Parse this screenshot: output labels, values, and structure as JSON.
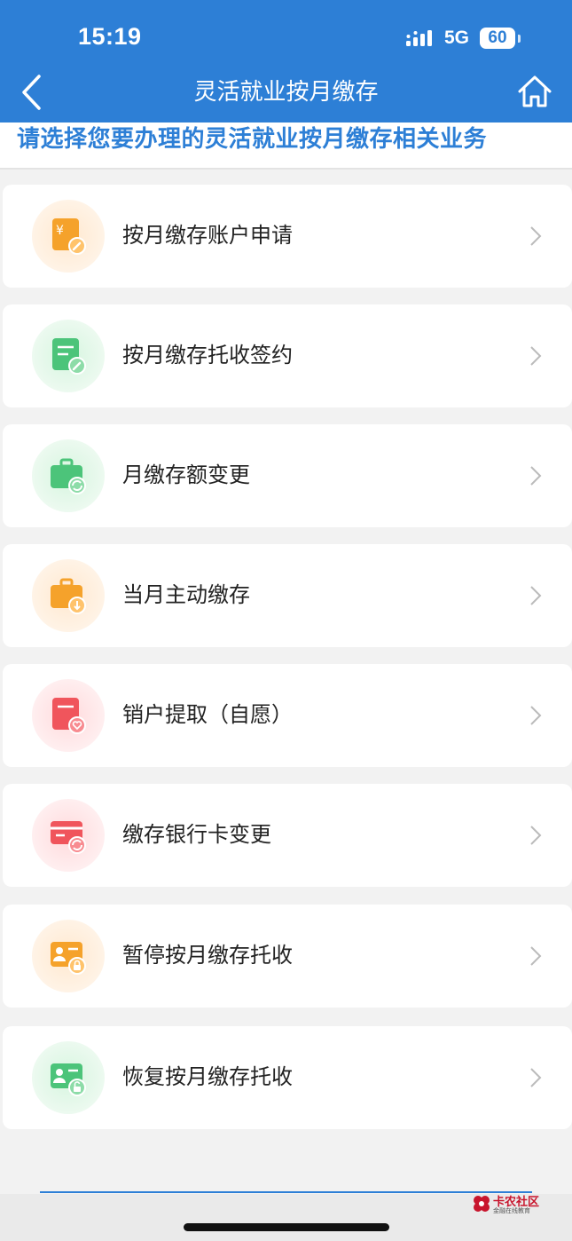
{
  "status_bar": {
    "time": "15:19",
    "network": "5G",
    "battery": "60"
  },
  "header": {
    "title": "灵活就业按月缴存",
    "back_icon": "chevron-left-icon",
    "home_icon": "home-icon"
  },
  "banner": {
    "text": "请选择您要办理的灵活就业按月缴存相关业务"
  },
  "menu": {
    "items": [
      {
        "label": "按月缴存账户申请",
        "icon": "account-apply-icon",
        "color": "#f5a22b"
      },
      {
        "label": "按月缴存托收签约",
        "icon": "contract-sign-icon",
        "color": "#4cc47a"
      },
      {
        "label": "月缴存额变更",
        "icon": "amount-change-icon",
        "color": "#4cc47a"
      },
      {
        "label": "当月主动缴存",
        "icon": "active-deposit-icon",
        "color": "#f5a22b"
      },
      {
        "label": "销户提取（自愿）",
        "icon": "close-account-icon",
        "color": "#f0555c"
      },
      {
        "label": "缴存银行卡变更",
        "icon": "bank-card-change-icon",
        "color": "#f0555c"
      },
      {
        "label": "暂停按月缴存托收",
        "icon": "pause-collection-icon",
        "color": "#f5a22b"
      },
      {
        "label": "恢复按月缴存托收",
        "icon": "resume-collection-icon",
        "color": "#4cc47a"
      }
    ]
  },
  "watermark": {
    "title": "卡农社区",
    "subtitle": "金融在线教育"
  }
}
